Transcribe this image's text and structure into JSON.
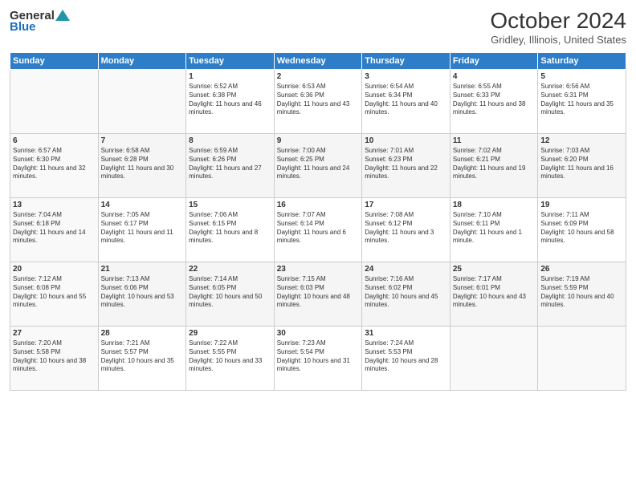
{
  "header": {
    "logo_general": "General",
    "logo_blue": "Blue",
    "month_title": "October 2024",
    "location": "Gridley, Illinois, United States"
  },
  "weekdays": [
    "Sunday",
    "Monday",
    "Tuesday",
    "Wednesday",
    "Thursday",
    "Friday",
    "Saturday"
  ],
  "weeks": [
    [
      {
        "day": "",
        "info": ""
      },
      {
        "day": "",
        "info": ""
      },
      {
        "day": "1",
        "info": "Sunrise: 6:52 AM\nSunset: 6:38 PM\nDaylight: 11 hours and 46 minutes."
      },
      {
        "day": "2",
        "info": "Sunrise: 6:53 AM\nSunset: 6:36 PM\nDaylight: 11 hours and 43 minutes."
      },
      {
        "day": "3",
        "info": "Sunrise: 6:54 AM\nSunset: 6:34 PM\nDaylight: 11 hours and 40 minutes."
      },
      {
        "day": "4",
        "info": "Sunrise: 6:55 AM\nSunset: 6:33 PM\nDaylight: 11 hours and 38 minutes."
      },
      {
        "day": "5",
        "info": "Sunrise: 6:56 AM\nSunset: 6:31 PM\nDaylight: 11 hours and 35 minutes."
      }
    ],
    [
      {
        "day": "6",
        "info": "Sunrise: 6:57 AM\nSunset: 6:30 PM\nDaylight: 11 hours and 32 minutes."
      },
      {
        "day": "7",
        "info": "Sunrise: 6:58 AM\nSunset: 6:28 PM\nDaylight: 11 hours and 30 minutes."
      },
      {
        "day": "8",
        "info": "Sunrise: 6:59 AM\nSunset: 6:26 PM\nDaylight: 11 hours and 27 minutes."
      },
      {
        "day": "9",
        "info": "Sunrise: 7:00 AM\nSunset: 6:25 PM\nDaylight: 11 hours and 24 minutes."
      },
      {
        "day": "10",
        "info": "Sunrise: 7:01 AM\nSunset: 6:23 PM\nDaylight: 11 hours and 22 minutes."
      },
      {
        "day": "11",
        "info": "Sunrise: 7:02 AM\nSunset: 6:21 PM\nDaylight: 11 hours and 19 minutes."
      },
      {
        "day": "12",
        "info": "Sunrise: 7:03 AM\nSunset: 6:20 PM\nDaylight: 11 hours and 16 minutes."
      }
    ],
    [
      {
        "day": "13",
        "info": "Sunrise: 7:04 AM\nSunset: 6:18 PM\nDaylight: 11 hours and 14 minutes."
      },
      {
        "day": "14",
        "info": "Sunrise: 7:05 AM\nSunset: 6:17 PM\nDaylight: 11 hours and 11 minutes."
      },
      {
        "day": "15",
        "info": "Sunrise: 7:06 AM\nSunset: 6:15 PM\nDaylight: 11 hours and 8 minutes."
      },
      {
        "day": "16",
        "info": "Sunrise: 7:07 AM\nSunset: 6:14 PM\nDaylight: 11 hours and 6 minutes."
      },
      {
        "day": "17",
        "info": "Sunrise: 7:08 AM\nSunset: 6:12 PM\nDaylight: 11 hours and 3 minutes."
      },
      {
        "day": "18",
        "info": "Sunrise: 7:10 AM\nSunset: 6:11 PM\nDaylight: 11 hours and 1 minute."
      },
      {
        "day": "19",
        "info": "Sunrise: 7:11 AM\nSunset: 6:09 PM\nDaylight: 10 hours and 58 minutes."
      }
    ],
    [
      {
        "day": "20",
        "info": "Sunrise: 7:12 AM\nSunset: 6:08 PM\nDaylight: 10 hours and 55 minutes."
      },
      {
        "day": "21",
        "info": "Sunrise: 7:13 AM\nSunset: 6:06 PM\nDaylight: 10 hours and 53 minutes."
      },
      {
        "day": "22",
        "info": "Sunrise: 7:14 AM\nSunset: 6:05 PM\nDaylight: 10 hours and 50 minutes."
      },
      {
        "day": "23",
        "info": "Sunrise: 7:15 AM\nSunset: 6:03 PM\nDaylight: 10 hours and 48 minutes."
      },
      {
        "day": "24",
        "info": "Sunrise: 7:16 AM\nSunset: 6:02 PM\nDaylight: 10 hours and 45 minutes."
      },
      {
        "day": "25",
        "info": "Sunrise: 7:17 AM\nSunset: 6:01 PM\nDaylight: 10 hours and 43 minutes."
      },
      {
        "day": "26",
        "info": "Sunrise: 7:19 AM\nSunset: 5:59 PM\nDaylight: 10 hours and 40 minutes."
      }
    ],
    [
      {
        "day": "27",
        "info": "Sunrise: 7:20 AM\nSunset: 5:58 PM\nDaylight: 10 hours and 38 minutes."
      },
      {
        "day": "28",
        "info": "Sunrise: 7:21 AM\nSunset: 5:57 PM\nDaylight: 10 hours and 35 minutes."
      },
      {
        "day": "29",
        "info": "Sunrise: 7:22 AM\nSunset: 5:55 PM\nDaylight: 10 hours and 33 minutes."
      },
      {
        "day": "30",
        "info": "Sunrise: 7:23 AM\nSunset: 5:54 PM\nDaylight: 10 hours and 31 minutes."
      },
      {
        "day": "31",
        "info": "Sunrise: 7:24 AM\nSunset: 5:53 PM\nDaylight: 10 hours and 28 minutes."
      },
      {
        "day": "",
        "info": ""
      },
      {
        "day": "",
        "info": ""
      }
    ]
  ]
}
